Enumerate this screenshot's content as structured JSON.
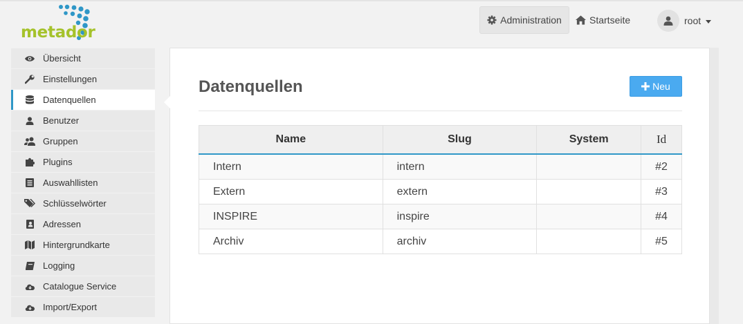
{
  "brand": {
    "logo_text": "metador",
    "colors": {
      "green": "#a5c22b",
      "blue": "#2f97c7"
    }
  },
  "topnav": {
    "admin_label": "Administration",
    "admin_icon": "gear-icon",
    "home_label": "Startseite",
    "home_icon": "home-icon",
    "user_label": "root"
  },
  "sidebar": {
    "items": [
      {
        "label": "Übersicht",
        "icon": "eye-icon"
      },
      {
        "label": "Einstellungen",
        "icon": "wrench-icon"
      },
      {
        "label": "Datenquellen",
        "icon": "database-icon",
        "active": true
      },
      {
        "label": "Benutzer",
        "icon": "user-icon"
      },
      {
        "label": "Gruppen",
        "icon": "users-icon"
      },
      {
        "label": "Plugins",
        "icon": "puzzle-icon"
      },
      {
        "label": "Auswahllisten",
        "icon": "list-icon"
      },
      {
        "label": "Schlüsselwörter",
        "icon": "tags-icon"
      },
      {
        "label": "Adressen",
        "icon": "address-book-icon"
      },
      {
        "label": "Hintergrundkarte",
        "icon": "map-icon"
      },
      {
        "label": "Logging",
        "icon": "book-icon"
      },
      {
        "label": "Catalogue Service",
        "icon": "cloud-icon"
      },
      {
        "label": "Import/Export",
        "icon": "cloud-icon"
      }
    ]
  },
  "main": {
    "title": "Datenquellen",
    "new_button_label": "Neu",
    "table": {
      "headers": {
        "name": "Name",
        "slug": "Slug",
        "system": "System",
        "id": "Id"
      },
      "rows": [
        {
          "name": "Intern",
          "slug": "intern",
          "system": "",
          "id": "#2"
        },
        {
          "name": "Extern",
          "slug": "extern",
          "system": "",
          "id": "#3"
        },
        {
          "name": "INSPIRE",
          "slug": "inspire",
          "system": "",
          "id": "#4"
        },
        {
          "name": "Archiv",
          "slug": "archiv",
          "system": "",
          "id": "#5"
        }
      ]
    }
  }
}
